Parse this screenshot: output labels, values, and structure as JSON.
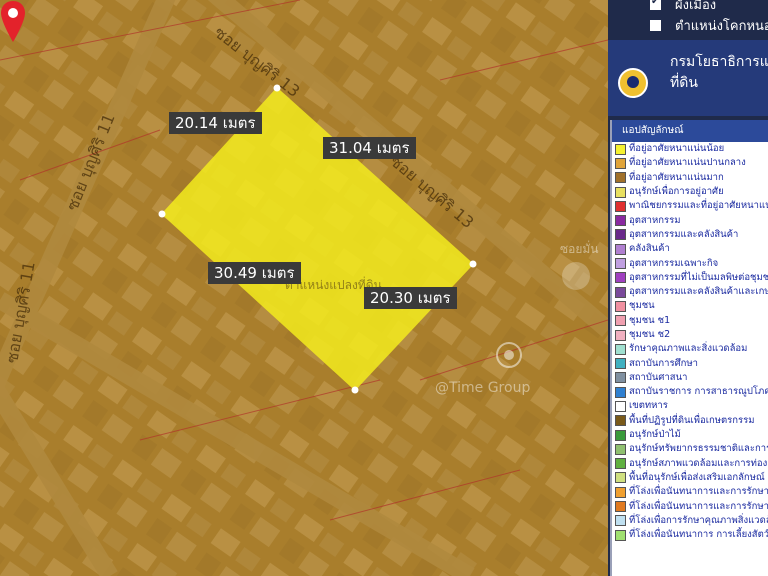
{
  "map": {
    "measurements": [
      "20.14 เมตร",
      "31.04 เมตร",
      "30.49 เมตร",
      "20.30 เมตร"
    ],
    "roads": [
      "ซอย บุญศิริ 11",
      "ซอย บุญศิริ 13",
      "ซอย บุญศิริ 11",
      "ซอย บุญศิริ 13"
    ],
    "parcel_caption": "ตำแหน่งแปลงที่ดิน",
    "poi_label": "@Time Group",
    "poi_label_2": "ซอยมั่น",
    "colors": {
      "parcel": "#f4ec1e",
      "overlay": "#c78a1a",
      "pin": "#e3222b"
    }
  },
  "panel": {
    "layers": [
      {
        "label": "ผังเมือง",
        "checked": true
      },
      {
        "label": "ตำแหน่งโคกหนอง",
        "checked": false
      }
    ],
    "department_title": "กรมโยธาธิการและผังเมือง",
    "department_sub": "ที่ดิน",
    "legend_title": "แอปสัญลักษณ์",
    "legend": [
      {
        "label": "ที่อยู่อาศัยหนาแน่นน้อย",
        "color": "#f6f230"
      },
      {
        "label": "ที่อยู่อาศัยหนาแน่นปานกลาง",
        "color": "#e0a43a"
      },
      {
        "label": "ที่อยู่อาศัยหนาแน่นมาก",
        "color": "#a0702a"
      },
      {
        "label": "อนุรักษ์เพื่อการอยู่อาศัย",
        "color": "#e8e060"
      },
      {
        "label": "พาณิชยกรรมและที่อยู่อาศัยหนาแน่นมาก",
        "color": "#e03030"
      },
      {
        "label": "อุตสาหกรรม",
        "color": "#8a2aa0"
      },
      {
        "label": "อุตสาหกรรมและคลังสินค้า",
        "color": "#6a2a8a"
      },
      {
        "label": "คลังสินค้า",
        "color": "#b080d0"
      },
      {
        "label": "อุตสาหกรรมเฉพาะกิจ",
        "color": "#c0a0e0"
      },
      {
        "label": "อุตสาหกรรมที่ไม่เป็นมลพิษต่อชุมชน",
        "color": "#a040c0"
      },
      {
        "label": "อุตสาหกรรมและคลังสินค้าและเกษตรกรรม",
        "color": "#7a4a9a"
      },
      {
        "label": "ชุมชน",
        "color": "#f090a0"
      },
      {
        "label": "ชุมชน ช1",
        "color": "#f0a0b0"
      },
      {
        "label": "ชุมชน ช2",
        "color": "#f0b0c0"
      },
      {
        "label": "รักษาคุณภาพและสิ่งแวดล้อม",
        "color": "#a0e0d0"
      },
      {
        "label": "สถาบันการศึกษา",
        "color": "#40b0c0"
      },
      {
        "label": "สถาบันศาสนา",
        "color": "#8090a0"
      },
      {
        "label": "สถาบันราชการ การสาธารณูปโภคและสาธารณูปการ",
        "color": "#3080d0"
      },
      {
        "label": "เขตทหาร",
        "color": "#ffffff"
      },
      {
        "label": "พื้นที่ปฏิรูปที่ดินเพื่อเกษตรกรรม",
        "color": "#7a5a1a"
      },
      {
        "label": "อนุรักษ์ป่าไม้",
        "color": "#3a9a3a"
      },
      {
        "label": "อนุรักษ์ทรัพยากรธรรมชาติและการท่องเที่ยว",
        "color": "#90c070"
      },
      {
        "label": "อนุรักษ์สภาพแวดล้อมและการท่องเที่ยว",
        "color": "#60b040"
      },
      {
        "label": "พื้นที่อนุรักษ์เพื่อส่งเสริมเอกลักษณ์",
        "color": "#d0e080"
      },
      {
        "label": "ที่โล่งเพื่อนันทนาการและการรักษา",
        "color": "#f0a030"
      },
      {
        "label": "ที่โล่งเพื่อนันทนาการและการรักษา",
        "color": "#e07a20"
      },
      {
        "label": "ที่โล่งเพื่อการรักษาคุณภาพสิ่งแวดล้อม",
        "color": "#c0e0f0"
      },
      {
        "label": "ที่โล่งเพื่อนันทนาการ การเลี้ยงสัตว์",
        "color": "#a0e070"
      }
    ]
  }
}
